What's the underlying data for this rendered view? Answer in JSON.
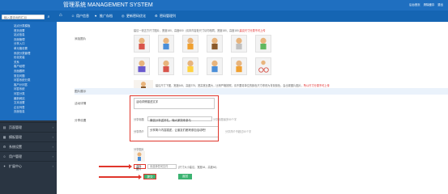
{
  "header": {
    "search_placeholder": "输入要查询的栏目",
    "app_title": "管理系统 MANAGEMENT SYSTEM",
    "tray": [
      "后台首页",
      "清除缓存",
      "退出"
    ],
    "brand_color": "#1f6fc0"
  },
  "topnav": {
    "items": [
      "用户信息",
      "推广存档",
      "更新密码优化",
      "密码管理列"
    ]
  },
  "sidebar": {
    "sub_items": [
      "站点分类模板",
      "首页设置",
      "站点信息",
      "页面管理",
      "分享入口",
      "单元格设置",
      "系统分类管理",
      "优化安装",
      "关系",
      "客户经理",
      "页面跟踪",
      "常见问题",
      "问答系统分类",
      "客户计问答",
      "问答系统",
      "问答分类",
      "最新网站",
      "文本设置",
      "企业列表",
      "页面信息"
    ],
    "categories": [
      "页面管理",
      "模板管理",
      "系统设置",
      "用户管理",
      "扩展中心"
    ]
  },
  "form": {
    "image_label": "添加图片",
    "image_hint_top": "建议一张正方尺寸图片，宽度180，高度600（请本内容处尺寸请勿相同，宽度180，高度180,",
    "image_hint_top_red": "建议尺寸分类不可上传",
    "image_hint_bottom": "建议尺寸下图，宽度645，高度375，宽高宽比要大，比例严格按照，请不要将单位的颜色尺寸修改为背景颜色，会出现图片图片，",
    "image_hint_bottom_red": "所以尺寸分类不可上传",
    "section_title": "图片展示",
    "content_label": "活动详情",
    "content_value": "活动详情描述文字",
    "share_label": "分享设置",
    "share_title_label": "分享标题",
    "share_title_value": "微信分享送好礼，嗨大家快来参与",
    "share_title_hint": "分享标题最多50个字",
    "share_desc_label": "分享简介",
    "share_desc_value": "分享简介内容描述，让朋友们都来参加活动吧！",
    "share_desc_hint": "分享简介不超过50个字",
    "share_img_label": "分享图片",
    "upload_btn": "选择图片",
    "upload_value": "未选择任何文件",
    "upload_hint": "(尺寸大小建议，宽度64，高度64)",
    "save_btn": "提交",
    "back_btn": "返回"
  }
}
